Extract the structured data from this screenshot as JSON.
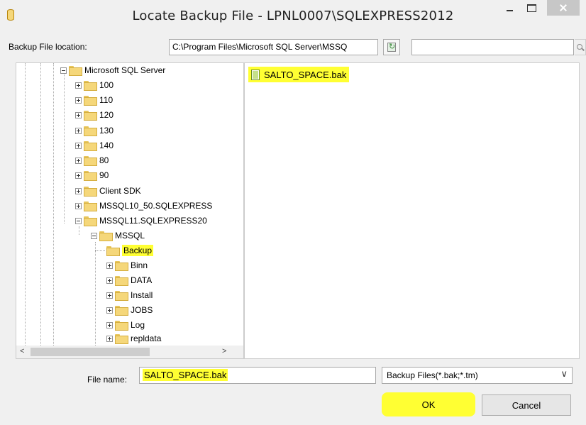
{
  "window": {
    "title": "Locate Backup File - LPNL0007\\SQLEXPRESS2012",
    "icon": "database-icon",
    "controls": [
      "minimize",
      "maximize",
      "close"
    ]
  },
  "location": {
    "label": "Backup File location:",
    "path": "C:\\Program Files\\Microsoft SQL Server\\MSSQ",
    "search_value": ""
  },
  "tree": {
    "items": [
      {
        "label": "Microsoft SQL Server",
        "state": "expanded"
      },
      {
        "label": "100",
        "state": "collapsed"
      },
      {
        "label": "110",
        "state": "collapsed"
      },
      {
        "label": "120",
        "state": "collapsed"
      },
      {
        "label": "130",
        "state": "collapsed"
      },
      {
        "label": "140",
        "state": "collapsed"
      },
      {
        "label": "80",
        "state": "collapsed"
      },
      {
        "label": "90",
        "state": "collapsed"
      },
      {
        "label": "Client SDK",
        "state": "collapsed"
      },
      {
        "label": "MSSQL10_50.SQLEXPRESS",
        "state": "collapsed"
      },
      {
        "label": "MSSQL11.SQLEXPRESS20",
        "state": "expanded"
      },
      {
        "label": "MSSQL",
        "state": "expanded"
      },
      {
        "label": "Backup",
        "state": "selected-leaf",
        "highlighted": true
      },
      {
        "label": "Binn",
        "state": "collapsed"
      },
      {
        "label": "DATA",
        "state": "collapsed"
      },
      {
        "label": "Install",
        "state": "collapsed"
      },
      {
        "label": "JOBS",
        "state": "collapsed"
      },
      {
        "label": "Log",
        "state": "collapsed"
      },
      {
        "label": "repldata",
        "state": "collapsed"
      }
    ]
  },
  "files": {
    "items": [
      {
        "name": "SALTO_SPACE.bak",
        "highlighted": true
      }
    ]
  },
  "footer": {
    "file_name_label": "File name:",
    "file_name_value": "SALTO_SPACE.bak",
    "filter_value": "Backup Files(*.bak;*.tm)",
    "ok_label": "OK",
    "cancel_label": "Cancel"
  },
  "colors": {
    "highlight": "#ffff33",
    "background": "#f0f0f0"
  }
}
